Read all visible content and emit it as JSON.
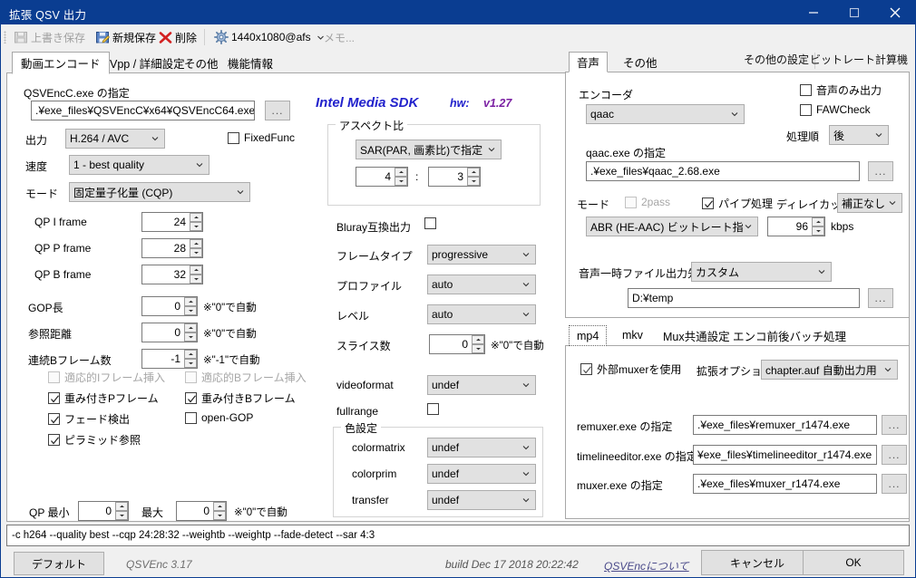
{
  "window": {
    "title": "拡張 QSV 出力",
    "controls": {
      "minimize": "minimize-icon",
      "maximize": "maximize-icon",
      "close": "close-icon"
    }
  },
  "toolbar": {
    "overwrite_save": "上書き保存",
    "new_save": "新規保存",
    "delete": "削除",
    "profile": "1440x1080@afs",
    "memo": "メモ...",
    "other_settings": "その他の設定",
    "bitrate_calc": "ビットレート計算機"
  },
  "main_tabs": [
    {
      "label": "動画エンコード",
      "active": true
    },
    {
      "label": "Vpp / 詳細設定",
      "active": false
    },
    {
      "label": "その他",
      "active": false
    },
    {
      "label": "機能情報",
      "active": false
    }
  ],
  "video": {
    "exe_label": "QSVEncC.exe の指定",
    "exe_value": ".¥exe_files¥QSVEncC¥x64¥QSVEncC64.exe",
    "browse": "...",
    "output_label": "出力",
    "output_value": "H.264 / AVC",
    "fixedfunc_label": "FixedFunc",
    "fixedfunc_checked": false,
    "speed_label": "速度",
    "speed_value": "1 - best quality",
    "mode_label": "モード",
    "mode_value": "固定量子化量 (CQP)",
    "qp_i_label": "QP I frame",
    "qp_i_value": "24",
    "qp_p_label": "QP P frame",
    "qp_p_value": "28",
    "qp_b_label": "QP B frame",
    "qp_b_value": "32",
    "gop_label": "GOP長",
    "gop_value": "0",
    "gop_note": "※\"0\"で自動",
    "ref_label": "参照距離",
    "ref_value": "0",
    "ref_note": "※\"0\"で自動",
    "bframes_label": "連続Bフレーム数",
    "bframes_value": "-1",
    "bframes_note": "※\"-1\"で自動",
    "adaptive_i_label": "適応的Iフレーム挿入",
    "adaptive_i_checked": false,
    "adaptive_i_disabled": true,
    "adaptive_b_label": "適応的Bフレーム挿入",
    "adaptive_b_checked": false,
    "adaptive_b_disabled": true,
    "weight_p_label": "重み付きPフレーム",
    "weight_p_checked": true,
    "weight_b_label": "重み付きBフレーム",
    "weight_b_checked": true,
    "fade_label": "フェード検出",
    "fade_checked": true,
    "opengop_label": "open-GOP",
    "opengop_checked": false,
    "pyramid_label": "ピラミッド参照",
    "pyramid_checked": true,
    "qpmin_label": "QP 最小",
    "qpmin_value": "0",
    "qpmax_label": "最大",
    "qpmax_value": "0",
    "qp_note": "※\"0\"で自動"
  },
  "sdk": {
    "name": "Intel Media SDK",
    "hw_label": "hw:",
    "version": "v1.27"
  },
  "aspect": {
    "group_title": "アスペクト比",
    "mode_value": "SAR(PAR, 画素比)で指定",
    "num_value": "4",
    "colon": ":",
    "den_value": "3"
  },
  "middle": {
    "bluray_label": "Bluray互換出力",
    "bluray_checked": false,
    "frametype_label": "フレームタイプ",
    "frametype_value": "progressive",
    "profile_label": "プロファイル",
    "profile_value": "auto",
    "level_label": "レベル",
    "level_value": "auto",
    "slices_label": "スライス数",
    "slices_value": "0",
    "slices_note": "※\"0\"で自動",
    "videoformat_label": "videoformat",
    "videoformat_value": "undef",
    "fullrange_label": "fullrange",
    "fullrange_checked": false,
    "color_group_title": "色設定",
    "colormatrix_label": "colormatrix",
    "colormatrix_value": "undef",
    "colorprim_label": "colorprim",
    "colorprim_value": "undef",
    "transfer_label": "transfer",
    "transfer_value": "undef"
  },
  "audio": {
    "tabs": [
      {
        "label": "音声",
        "active": true
      },
      {
        "label": "その他",
        "active": false
      }
    ],
    "encoder_label": "エンコーダ",
    "encoder_value": "qaac",
    "audio_only_label": "音声のみ出力",
    "audio_only_checked": false,
    "fawcheck_label": "FAWCheck",
    "fawcheck_checked": false,
    "order_label": "処理順",
    "order_value": "後",
    "exe_label": "qaac.exe の指定",
    "exe_value": ".¥exe_files¥qaac_2.68.exe",
    "browse": "...",
    "mode_label": "モード",
    "twopass_label": "2pass",
    "twopass_checked": false,
    "twopass_disabled": true,
    "pipe_label": "パイプ処理",
    "pipe_checked": true,
    "delaycut_label": "ディレイカット",
    "delaycut_value": "補正なし",
    "bitrate_mode_value": "ABR (HE-AAC) ビットレート指定",
    "bitrate_value": "96",
    "bitrate_unit": "kbps",
    "temp_label": "音声一時ファイル出力先",
    "temp_mode_value": "カスタム",
    "temp_path": "D:¥temp"
  },
  "mux": {
    "tabs": [
      {
        "label": "mp4",
        "active": true
      },
      {
        "label": "mkv",
        "active": false
      },
      {
        "label": "Mux共通設定",
        "active": false
      },
      {
        "label": "エンコ前後バッチ処理",
        "active": false
      }
    ],
    "external_muxer_label": "外部muxerを使用",
    "external_muxer_checked": true,
    "ext_option_label": "拡張オプション",
    "ext_option_value": "chapter.auf 自動出力用",
    "remuxer_label": "remuxer.exe の指定",
    "remuxer_value": ".¥exe_files¥remuxer_r1474.exe",
    "timeline_label": "timelineeditor.exe の指定",
    "timeline_value": "¥exe_files¥timelineeditor_r1474.exe",
    "muxer_label": "muxer.exe の指定",
    "muxer_value": ".¥exe_files¥muxer_r1474.exe",
    "browse": "..."
  },
  "footer": {
    "command_line": "-c h264 --quality best --cqp 24:28:32 --weightb --weightp --fade-detect --sar 4:3",
    "default_button": "デフォルト",
    "version": "QSVEnc 3.17",
    "build": "build Dec 17 2018 20:22:42",
    "about_link": "QSVEncについて",
    "cancel_button": "キャンセル",
    "ok_button": "OK"
  },
  "colors": {
    "titlebar": "#0a3d91",
    "accent_blue": "#2222cc",
    "accent_purple": "#7a1fa2",
    "panel_bg": "#f0f0f0"
  }
}
